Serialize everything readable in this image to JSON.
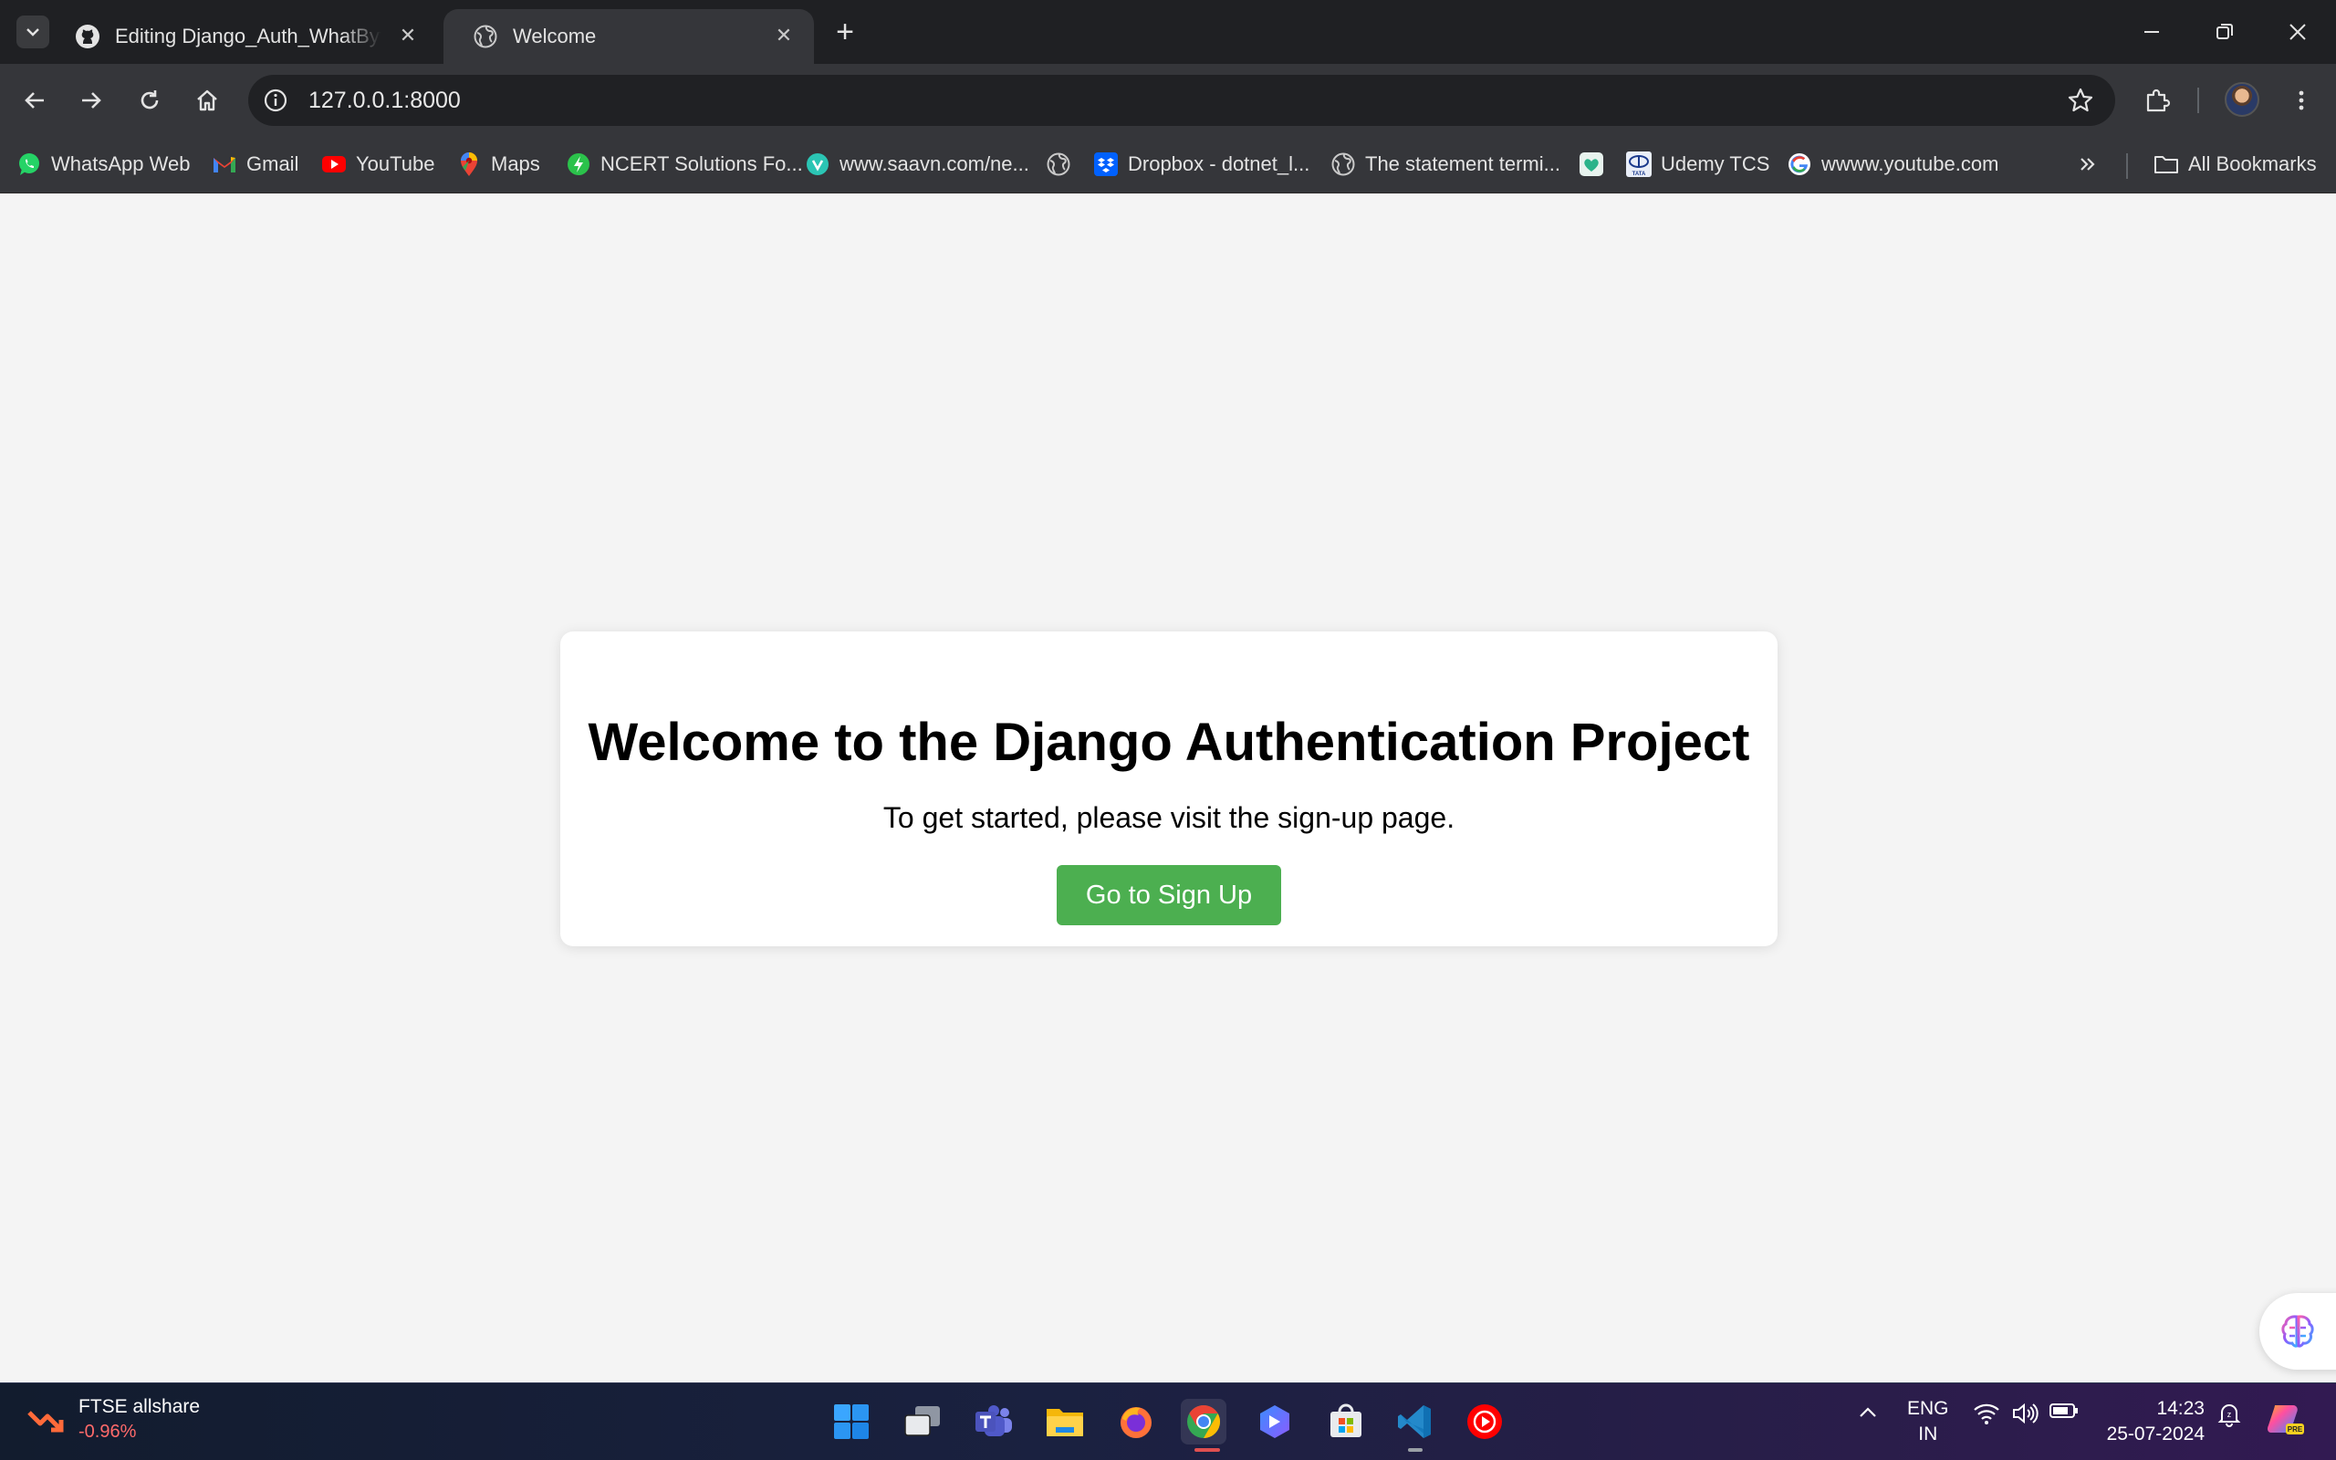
{
  "browser": {
    "tabs": [
      {
        "title": "Editing Django_Auth_WhatBytes",
        "icon": "github-icon"
      },
      {
        "title": "Welcome",
        "icon": "globe-icon",
        "active": true
      }
    ],
    "url": "127.0.0.1:8000",
    "bookmarks": [
      {
        "label": "WhatsApp Web",
        "icon": "whatsapp-icon"
      },
      {
        "label": "Gmail",
        "icon": "gmail-icon"
      },
      {
        "label": "YouTube",
        "icon": "youtube-icon"
      },
      {
        "label": "Maps",
        "icon": "maps-icon"
      },
      {
        "label": "NCERT Solutions Fo...",
        "icon": "ncert-icon"
      },
      {
        "label": "www.saavn.com/ne...",
        "icon": "saavn-icon"
      },
      {
        "label": "",
        "icon": "globe-icon"
      },
      {
        "label": "Dropbox - dotnet_l...",
        "icon": "dropbox-icon"
      },
      {
        "label": "The statement termi...",
        "icon": "globe-icon"
      },
      {
        "label": "",
        "icon": "heart-app-icon"
      },
      {
        "label": "Udemy TCS",
        "icon": "tata-icon"
      },
      {
        "label": "wwww.youtube.com",
        "icon": "google-icon"
      }
    ],
    "all_bookmarks_label": "All Bookmarks"
  },
  "page": {
    "heading": "Welcome to the Django Authentication Project",
    "subtext": "To get started, please visit the sign-up page.",
    "cta_label": "Go to Sign Up",
    "cta_color": "#4caf50"
  },
  "taskbar": {
    "widget": {
      "name": "FTSE allshare",
      "value": "-0.96%",
      "value_color": "#ff6a6a"
    },
    "apps": [
      "start-icon",
      "task-view-icon",
      "teams-icon",
      "file-explorer-icon",
      "firefox-icon",
      "chrome-icon",
      "copilot-icon",
      "store-icon",
      "vscode-icon",
      "youtube-music-icon"
    ],
    "language": {
      "line1": "ENG",
      "line2": "IN"
    },
    "time": "14:23",
    "date": "25-07-2024"
  }
}
